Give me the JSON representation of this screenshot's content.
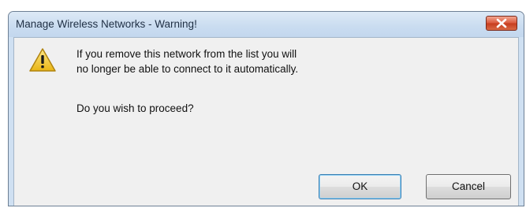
{
  "dialog": {
    "title": "Manage Wireless Networks - Warning!",
    "close_icon": "close-icon",
    "warning_icon": "warning-icon",
    "message_lines": [
      "If you remove this network from the list you will",
      "no longer be able to connect to it automatically."
    ],
    "question": "Do you wish to proceed?",
    "ok_label": "OK",
    "cancel_label": "Cancel"
  },
  "colors": {
    "titlebar": "#c9dcf0",
    "client_background": "#f0f0f0",
    "close_button": "#d9573a",
    "warning_yellow": "#f3c623"
  }
}
